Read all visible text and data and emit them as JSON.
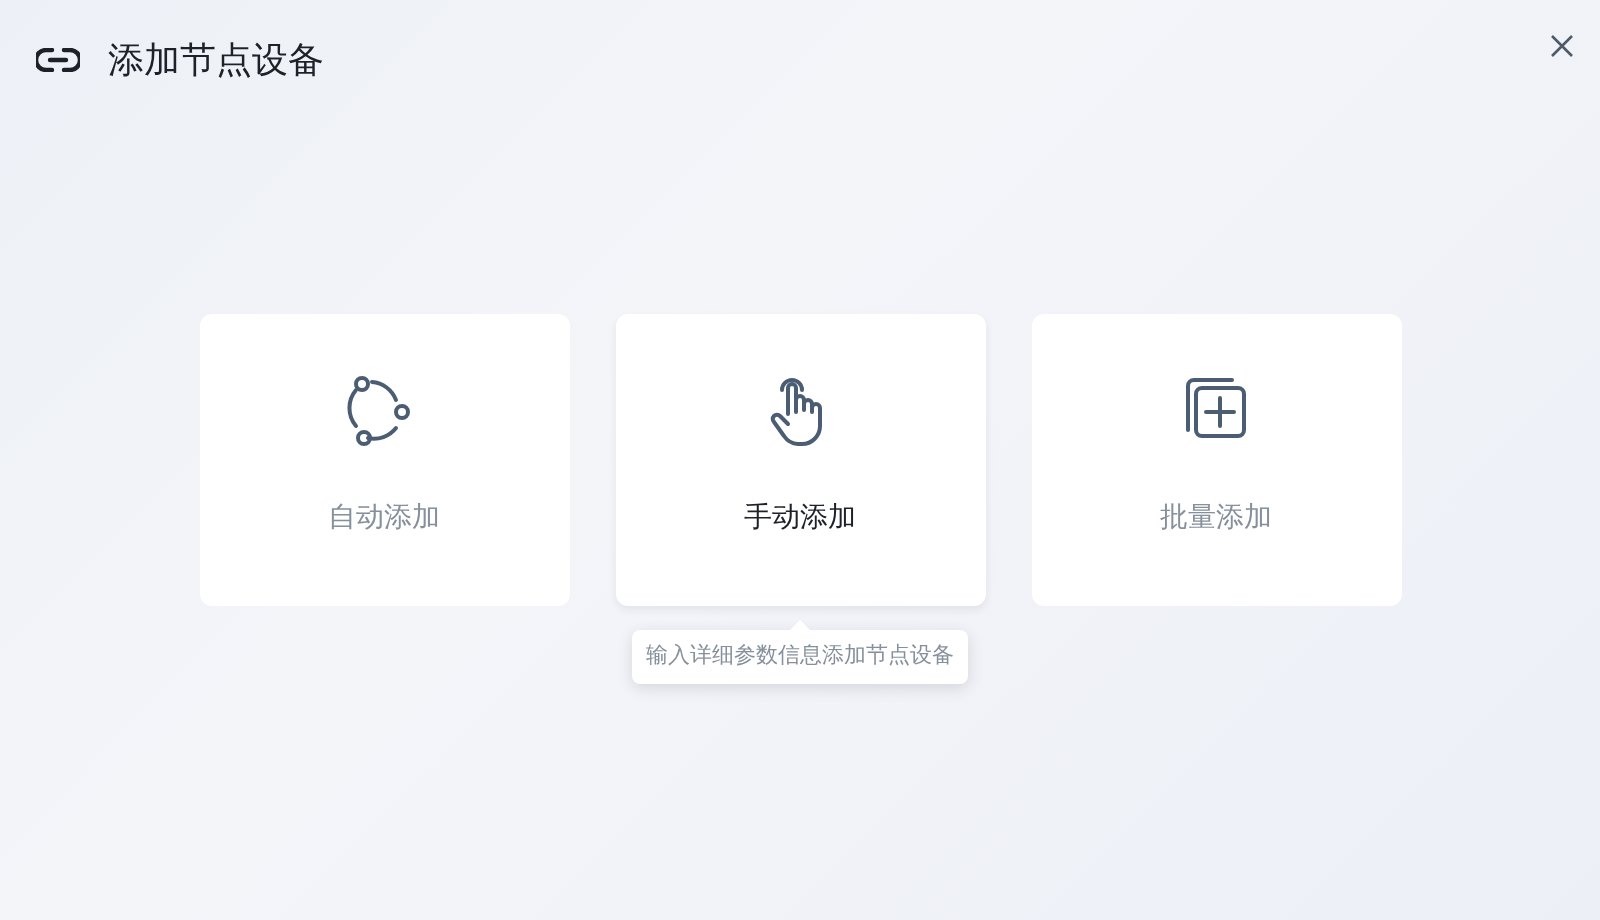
{
  "dialog": {
    "title": "添加节点设备"
  },
  "options": [
    {
      "kind": "auto",
      "label": "自动添加",
      "selected": false
    },
    {
      "kind": "manual",
      "label": "手动添加",
      "selected": true,
      "tooltip": "输入详细参数信息添加节点设备"
    },
    {
      "kind": "batch",
      "label": "批量添加",
      "selected": false
    }
  ]
}
